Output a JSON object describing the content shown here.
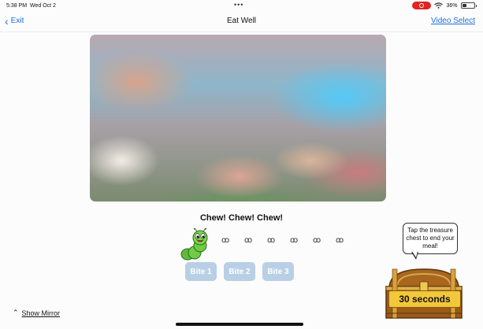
{
  "status_bar": {
    "time": "5:38 PM",
    "date": "Wed Oct 2",
    "battery": "36%"
  },
  "nav": {
    "back_label": "Exit",
    "title": "Eat Well",
    "right_label": "Video Select"
  },
  "main": {
    "prompt": "Chew! Chew! Chew!",
    "bites": [
      "Bite 1",
      "Bite 2",
      "Bite 3"
    ],
    "treasure_hint": "Tap the treasure chest to end your meal!",
    "timer": "30 seconds",
    "ant_count": 6
  },
  "footer": {
    "mirror_label": "Show Mirror"
  },
  "colors": {
    "accent": "#1e6fd9",
    "bite_button": "#b9cfe6",
    "timer_banner": "#f2c73a",
    "record": "#e02424"
  }
}
